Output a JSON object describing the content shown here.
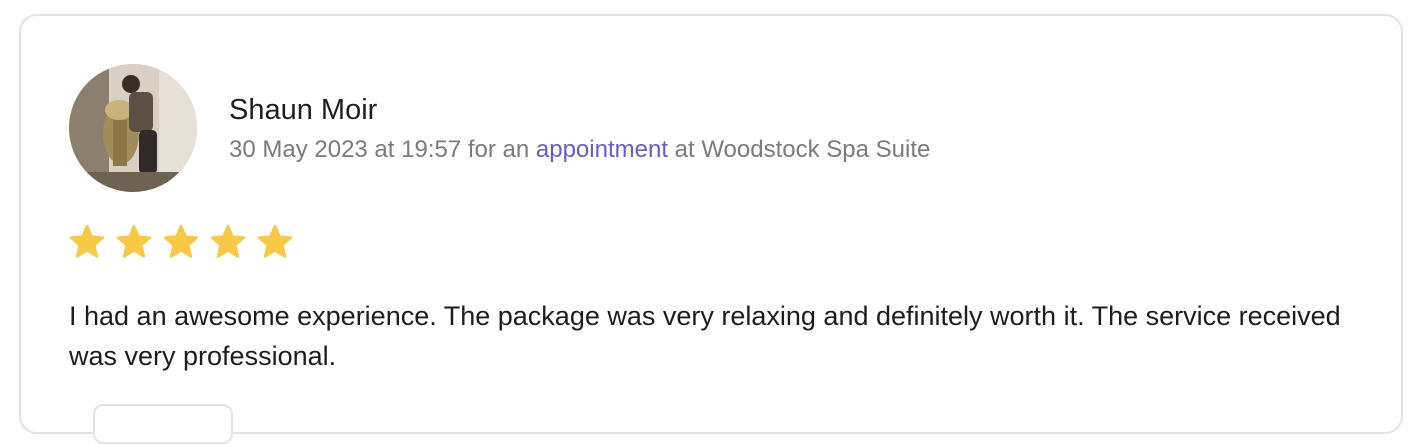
{
  "review": {
    "reviewer_name": "Shaun Moir",
    "date": "30 May 2023 at 19:57",
    "for_text": "for an",
    "link_text": "appointment",
    "at_text": "at Woodstock Spa Suite",
    "rating": 5,
    "rating_max": 5,
    "text": "I had an awesome experience. The package was very relaxing and definitely worth it. The service received was very professional."
  },
  "colors": {
    "star": "#f7c946",
    "link": "#6a5bc6",
    "meta": "#7a7a80",
    "border": "#e3e3e6"
  },
  "icons": {
    "star": "star-icon",
    "avatar": "avatar-photo"
  }
}
